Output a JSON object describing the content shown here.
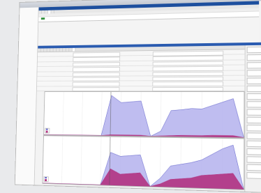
{
  "window": {
    "title": "",
    "title_right": ""
  },
  "sidebar": {
    "items": [
      "",
      "",
      "",
      "",
      "",
      "",
      "",
      "",
      "",
      "",
      "",
      "",
      "",
      "",
      "",
      "",
      "",
      "",
      "",
      "",
      "",
      "",
      "",
      "",
      "",
      "",
      "",
      "",
      "",
      "",
      "",
      "",
      "",
      ""
    ]
  },
  "top_tabs": [
    "",
    "",
    "",
    "",
    ""
  ],
  "table": {
    "columns": [
      "",
      "",
      "",
      "",
      "",
      "",
      "",
      "",
      "",
      "",
      "",
      ""
    ],
    "rows": [
      [
        "",
        "",
        "",
        "",
        "",
        "",
        "",
        "",
        "",
        "",
        "",
        ""
      ]
    ]
  },
  "bottom_tabs": [
    "",
    "",
    "",
    "",
    "",
    "",
    "",
    "",
    "",
    "",
    "",
    ""
  ],
  "properties": [
    {
      "key": "",
      "v1": "",
      "v2": ""
    },
    {
      "key": "",
      "v1": "",
      "v2": ""
    },
    {
      "key": "",
      "v1": "",
      "v2": ""
    },
    {
      "key": "",
      "v1": "",
      "v2": ""
    },
    {
      "key": "",
      "v1": "",
      "v2": ""
    },
    {
      "key": "",
      "v1": "",
      "v2": ""
    },
    {
      "key": "",
      "v1": "",
      "v2": ""
    },
    {
      "key": "",
      "v1": "",
      "v2": ""
    }
  ],
  "right_buttons": [
    "",
    "",
    "",
    "",
    "",
    "",
    "",
    "",
    "",
    "",
    "",
    "",
    "",
    "",
    "",
    "",
    ""
  ],
  "colors": {
    "accent": "#2a5bb0",
    "series_blue": "#5a5cc8",
    "series_magenta": "#b02a7a",
    "fill_lavender": "#b8b6ee"
  },
  "chart_data": [
    {
      "type": "area",
      "title": "",
      "xlabel": "",
      "ylabel": "",
      "marker_label": "",
      "x": [
        0,
        5,
        10,
        15,
        20,
        25,
        30,
        35,
        40,
        45,
        50,
        55,
        60,
        65,
        70,
        75,
        80,
        85,
        90,
        95,
        100
      ],
      "series": [
        {
          "name": "",
          "values": [
            0,
            0,
            0,
            0,
            0,
            0,
            0,
            95,
            78,
            80,
            82,
            0,
            12,
            60,
            62,
            65,
            64,
            72,
            80,
            88,
            0
          ]
        },
        {
          "name": "",
          "values": [
            0,
            0,
            0,
            0,
            0,
            0,
            0,
            2,
            2,
            2,
            2,
            0,
            1,
            2,
            3,
            3,
            3,
            4,
            4,
            4,
            0
          ]
        }
      ],
      "ylim": [
        0,
        100
      ],
      "legend": "bottom-left"
    },
    {
      "type": "area",
      "title": "",
      "xlabel": "",
      "ylabel": "",
      "x": [
        0,
        5,
        10,
        15,
        20,
        25,
        30,
        35,
        40,
        45,
        50,
        55,
        60,
        65,
        70,
        75,
        80,
        85,
        90,
        95,
        100
      ],
      "series": [
        {
          "name": "",
          "values": [
            0,
            0,
            0,
            0,
            0,
            0,
            0,
            70,
            62,
            64,
            66,
            0,
            18,
            44,
            48,
            52,
            58,
            70,
            82,
            90,
            0
          ]
        },
        {
          "name": "",
          "values": [
            0,
            0,
            0,
            0,
            0,
            0,
            0,
            35,
            24,
            26,
            28,
            0,
            6,
            16,
            18,
            20,
            26,
            28,
            30,
            32,
            0
          ]
        }
      ],
      "ylim": [
        0,
        100
      ],
      "legend": "bottom-left"
    }
  ]
}
